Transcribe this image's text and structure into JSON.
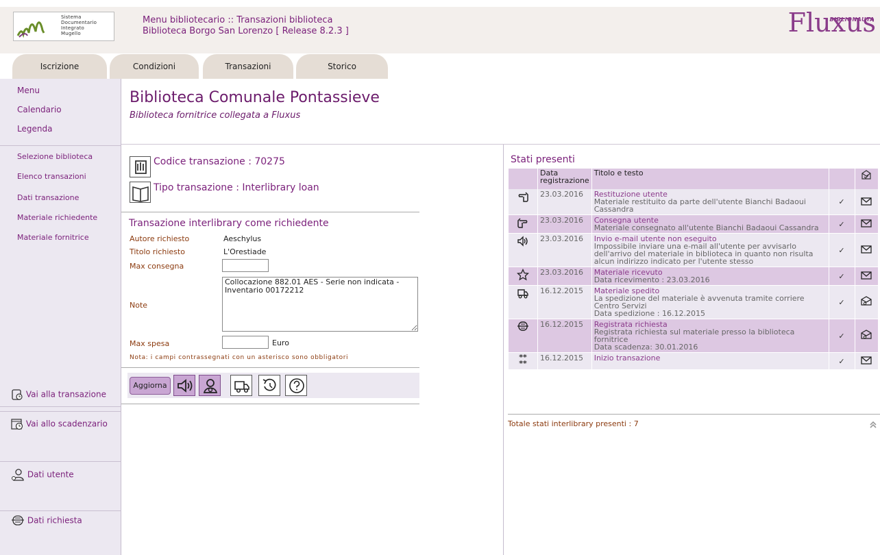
{
  "header": {
    "logo_lines": [
      "Sistema",
      "Documentario",
      "Integrato",
      "Mugello"
    ],
    "title_line1": "Menu bibliotecario :: Transazioni biblioteca",
    "title_line2": "Biblioteca Borgo San Lorenzo [ Release 8.2.3 ]",
    "brand": "Fluxus",
    "brand_tag": "BIBLIONAUTA",
    "brand_color": "#8a3c8a"
  },
  "tabs": [
    {
      "label": "Iscrizione"
    },
    {
      "label": "Condizioni"
    },
    {
      "label": "Transazioni"
    },
    {
      "label": "Storico"
    }
  ],
  "sidebar": {
    "top_items": [
      {
        "label": "Menu"
      },
      {
        "label": "Calendario"
      },
      {
        "label": "Legenda"
      }
    ],
    "nav_items": [
      {
        "label": "Selezione biblioteca"
      },
      {
        "label": "Elenco transazioni"
      },
      {
        "label": "Dati transazione"
      },
      {
        "label": "Materiale richiedente"
      },
      {
        "label": "Materiale fornitrice"
      }
    ],
    "quick_links": [
      {
        "label": "Vai alla transazione",
        "icon": "transaction-icon"
      },
      {
        "label": "Vai allo scadenzario",
        "icon": "calendar-clock-icon"
      },
      {
        "label": "Dati utente",
        "icon": "user-key-icon"
      },
      {
        "label": "Dati richiesta",
        "icon": "request-icon"
      }
    ]
  },
  "main": {
    "library_title": "Biblioteca Comunale Pontassieve",
    "library_subtitle": "Biblioteca fornitrice collegata a Fluxus",
    "codice_transazione": "Codice transazione : 70275",
    "tipo_transazione": "Tipo transazione : Interlibrary loan",
    "form_title": "Transazione interlibrary come richiedente",
    "fields": {
      "autore_label": "Autore richiesto",
      "autore_value": "Aeschylus",
      "titolo_label": "Titolo richiesto",
      "titolo_value": "L'Orestiade",
      "max_consegna_label": "Max consegna",
      "max_consegna_value": "",
      "note_label": "Note",
      "note_value": "Collocazione 882.01 AES - Serie non indicata - Inventario 00172212",
      "max_spesa_label": "Max spesa",
      "max_spesa_value": "",
      "euro_label": "Euro"
    },
    "nota": "Nota: i campi contrassegnati con un asterisco sono obbligatori",
    "aggiorna_label": "Aggiorna",
    "action_icons": [
      "speaker-icon",
      "user-badge-icon",
      "truck-icon",
      "undo-icon",
      "help-icon"
    ]
  },
  "stati": {
    "title": "Stati presenti",
    "headers": {
      "date": "Data registrazione",
      "title": "Titolo e testo"
    },
    "rows": [
      {
        "icon": "hand-left-icon",
        "date": "23.03.2016",
        "title": "Restituzione utente",
        "text": "Materiale restituito da parte dell'utente Bianchi Badaoui Cassandra",
        "mail": "envelope-icon"
      },
      {
        "icon": "hand-right-icon",
        "date": "23.03.2016",
        "title": "Consegna utente",
        "text": "Materiale consegnato all'utente Bianchi Badaoui Cassandra",
        "mail": "envelope-icon"
      },
      {
        "icon": "speaker-icon",
        "date": "23.03.2016",
        "title": "Invio e-mail utente non eseguito",
        "text": "Impossibile inviare una e-mail all'utente per avvisarlo dell'arrivo del materiale in biblioteca in quanto non risulta alcun indirizzo indicato per l'utente stesso",
        "mail": "envelope-icon"
      },
      {
        "icon": "star-icon",
        "date": "23.03.2016",
        "title": "Materiale ricevuto",
        "text": "Data ricevimento : 23.03.2016",
        "mail": "envelope-icon"
      },
      {
        "icon": "truck-icon",
        "date": "16.12.2015",
        "title": "Materiale spedito",
        "text": "La spedizione del materiale è avvenuta tramite corriere Centro Servizi\nData spedizione : 16.12.2015",
        "mail": "envelope-search-icon"
      },
      {
        "icon": "request-icon",
        "date": "16.12.2015",
        "title": "Registrata richiesta",
        "text": "Registrata richiesta sul materiale presso la biblioteca fornitrice\nData scadenza: 30.01.2016",
        "mail": "envelope-search-icon"
      },
      {
        "icon": "asterisks-icon",
        "date": "16.12.2015",
        "title": "Inizio transazione",
        "text": "",
        "mail": "envelope-icon"
      }
    ],
    "check_glyph": "✓",
    "asterisks_glyph": "** **",
    "totale": "Totale stati interlibrary presenti : 7"
  }
}
